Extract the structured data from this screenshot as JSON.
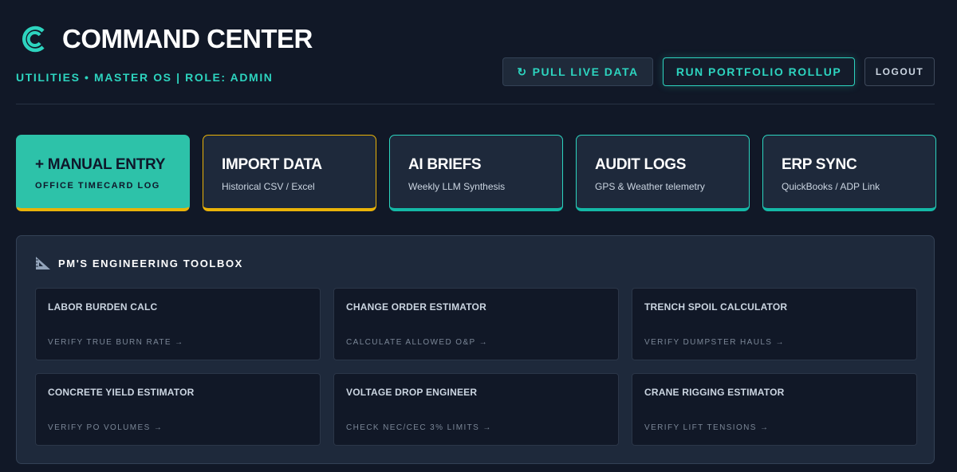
{
  "header": {
    "title": "COMMAND CENTER",
    "subtitle": "UTILITIES • MASTER OS | ROLE: ADMIN",
    "actions": {
      "pull_icon": "↻",
      "pull_label": "PULL LIVE DATA",
      "rollup_label": "RUN PORTFOLIO ROLLUP",
      "logout_label": "LOGOUT"
    }
  },
  "cards": [
    {
      "title": "+ MANUAL ENTRY",
      "subtitle": "OFFICE TIMECARD LOG"
    },
    {
      "title": "IMPORT DATA",
      "subtitle": "Historical CSV / Excel"
    },
    {
      "title": "AI BRIEFS",
      "subtitle": "Weekly LLM Synthesis"
    },
    {
      "title": "AUDIT LOGS",
      "subtitle": "GPS & Weather telemetry"
    },
    {
      "title": "ERP SYNC",
      "subtitle": "QuickBooks / ADP Link"
    }
  ],
  "toolbox": {
    "title": "PM'S ENGINEERING TOOLBOX",
    "tools": [
      {
        "title": "LABOR BURDEN CALC",
        "link": "VERIFY TRUE BURN RATE →"
      },
      {
        "title": "CHANGE ORDER ESTIMATOR",
        "link": "CALCULATE ALLOWED O&P →"
      },
      {
        "title": "TRENCH SPOIL CALCULATOR",
        "link": "VERIFY DUMPSTER HAULS →"
      },
      {
        "title": "CONCRETE YIELD ESTIMATOR",
        "link": "VERIFY PO VOLUMES →"
      },
      {
        "title": "VOLTAGE DROP ENGINEER",
        "link": "CHECK NEC/CEC 3% LIMITS →"
      },
      {
        "title": "CRANE RIGGING ESTIMATOR",
        "link": "VERIFY LIFT TENSIONS →"
      }
    ]
  },
  "colors": {
    "background": "#111827",
    "panel": "#1e293b",
    "accent_teal": "#2dd4bf",
    "accent_yellow": "#eab308"
  }
}
